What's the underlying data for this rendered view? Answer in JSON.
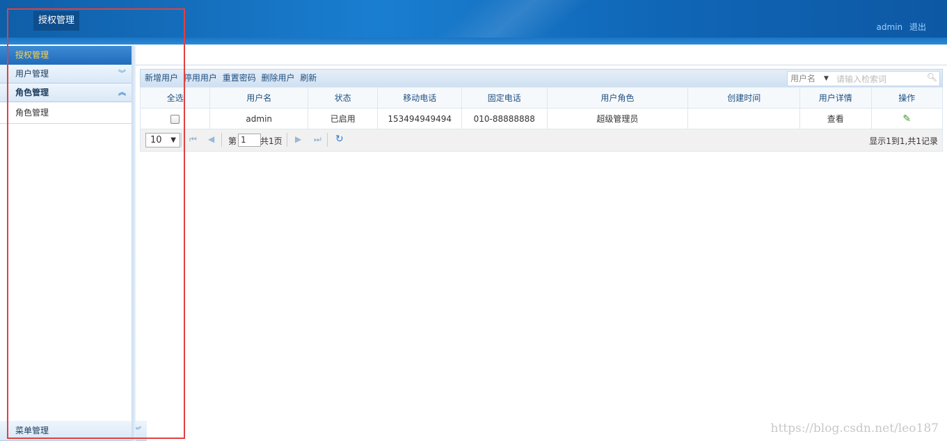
{
  "header": {
    "active_tab": "授权管理",
    "user": "admin",
    "logout": "退出"
  },
  "sidebar": {
    "title": "授权管理",
    "groups": [
      {
        "label": "用户管理",
        "expanded": false
      },
      {
        "label": "角色管理",
        "expanded": true,
        "children": [
          "角色管理"
        ]
      }
    ],
    "bottom_group": "菜单管理"
  },
  "toolbar": {
    "buttons": [
      "新增用户",
      "停用用户",
      "重置密码",
      "删除用户",
      "刷新"
    ],
    "search_field": "用户名",
    "search_placeholder": "请输入检索词"
  },
  "table": {
    "columns": [
      "全选",
      "用户名",
      "状态",
      "移动电话",
      "固定电话",
      "用户角色",
      "创建时间",
      "用户详情",
      "操作"
    ],
    "rows": [
      {
        "username": "admin",
        "status": "已启用",
        "mobile": "153494949494",
        "phone": "010-88888888",
        "role": "超级管理员",
        "created": "",
        "detail": "查看"
      }
    ]
  },
  "pager": {
    "page_size": "10",
    "page_prefix": "第",
    "page_number": "1",
    "page_total": "共1页",
    "info": "显示1到1,共1记录"
  },
  "watermark": "https://blog.csdn.net/leo187",
  "colors": {
    "header_blue": "#1a7ed0",
    "sidebar_head": "#2f7bc9",
    "highlight_box": "#e04040",
    "accent_text": "#ffd24a"
  }
}
